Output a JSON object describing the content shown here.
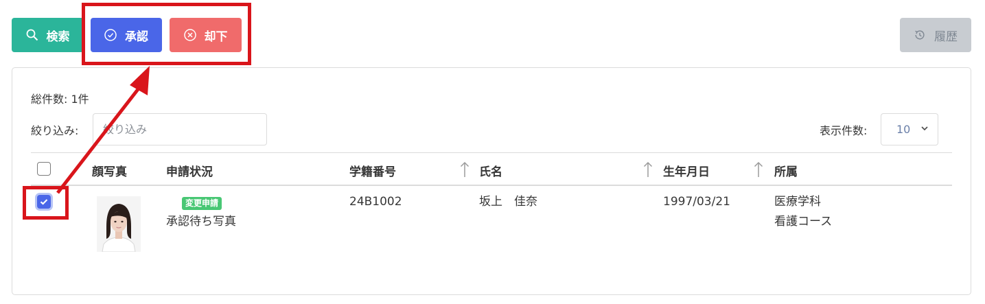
{
  "toolbar": {
    "search_label": "検索",
    "approve_label": "承認",
    "reject_label": "却下",
    "history_label": "履歴"
  },
  "list": {
    "total": "総件数: 1件",
    "filter_label": "絞り込み:",
    "filter_placeholder": "絞り込み",
    "perpage_label": "表示件数:",
    "perpage_value": "10"
  },
  "table": {
    "headers": {
      "photo": "顔写真",
      "status": "申請状況",
      "student_id": "学籍番号",
      "name": "氏名",
      "birthdate": "生年月日",
      "affiliation": "所属"
    },
    "rows": [
      {
        "checked": true,
        "badge": "変更申請",
        "status": "承認待ち写真",
        "student_id": "24B1002",
        "name": "坂上　佳奈",
        "birthdate": "1997/03/21",
        "affiliation_line1": "医療学科",
        "affiliation_line2": "看護コース"
      }
    ]
  },
  "colors": {
    "search": "#2bb59a",
    "approve": "#4a66e8",
    "reject": "#f06b6b",
    "history": "#c8ccd1",
    "highlight": "#d9151b",
    "badge": "#48c774"
  }
}
